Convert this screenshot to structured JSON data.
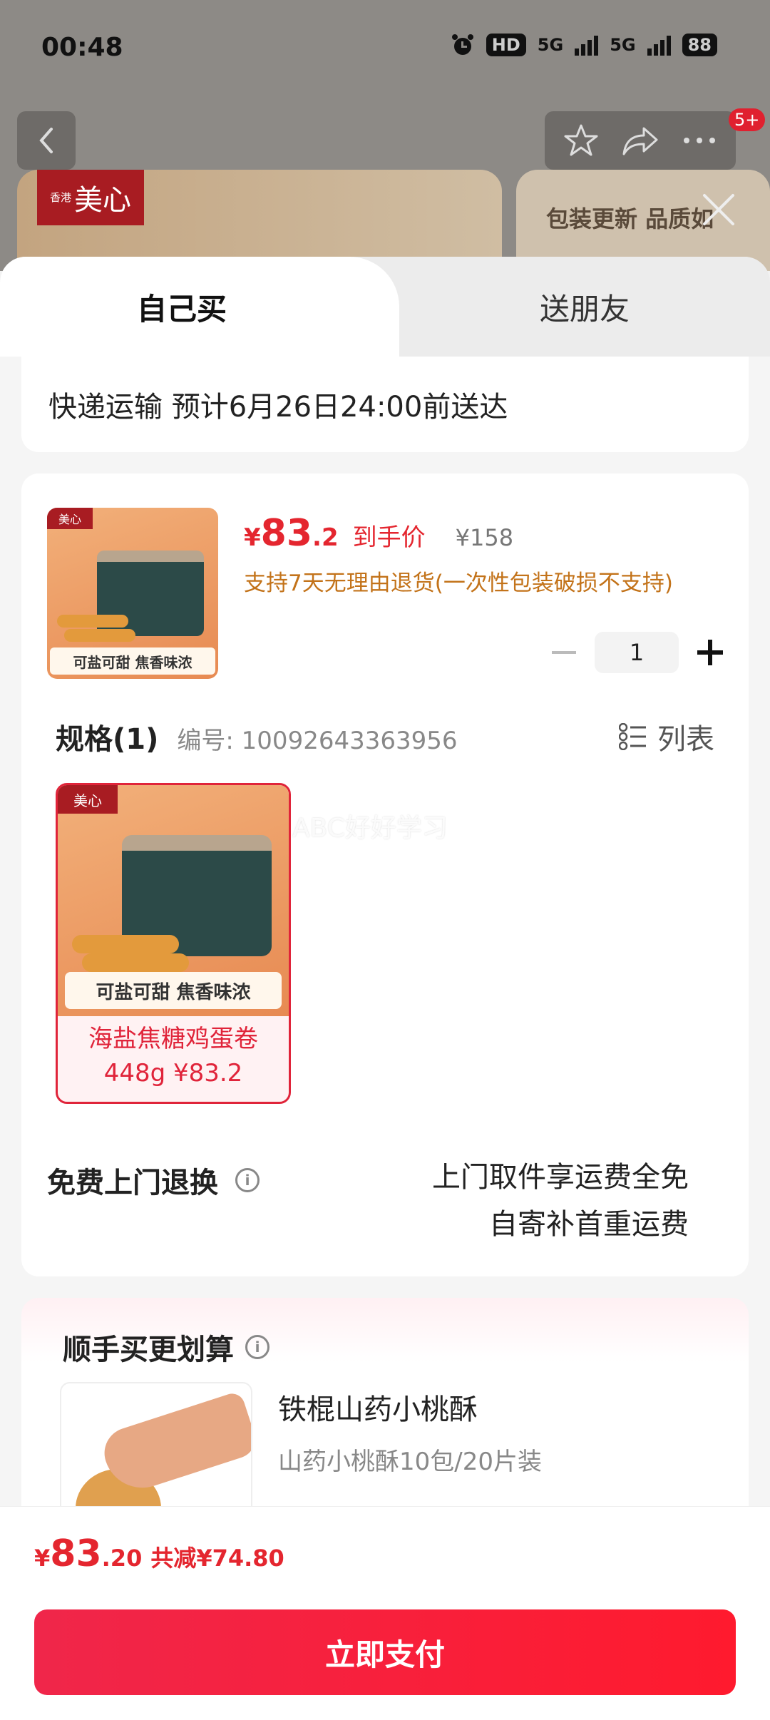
{
  "status_bar": {
    "time": "00:48",
    "hd": "HD",
    "net1": "5G",
    "net2": "5G",
    "battery": "88"
  },
  "nav": {
    "badge": "5+"
  },
  "background": {
    "brand_small": "香港",
    "brand_main": "美心",
    "banner_text": "包装更新 品质如"
  },
  "tabs": {
    "self_buy": "自己买",
    "gift": "送朋友"
  },
  "delivery": {
    "text": "快递运输 预计6月26日24:00前送达"
  },
  "product": {
    "thumb_logo": "美心",
    "thumb_label": "可盐可甜 焦香味浓",
    "price_currency": "¥",
    "price_int": "83",
    "price_dec": ".2",
    "price_tag": "到手价",
    "original_price": "¥158",
    "return_note": "支持7天无理由退货(一次性包装破损不支持)",
    "quantity": "1"
  },
  "spec": {
    "title": "规格(1)",
    "code": "编号: 10092643363956",
    "list_label": "列表",
    "item_logo": "美心",
    "item_label": "可盐可甜 焦香味浓",
    "item_name_line1": "海盐焦糖鸡蛋卷",
    "item_name_line2": "448g ¥83.2",
    "watermark": "ABC好好学习"
  },
  "free_return": {
    "title": "免费上门退换",
    "line1": "上门取件享运费全免",
    "line2": "自寄补首重运费"
  },
  "upsell": {
    "title": "顺手买更划算",
    "item_name": "铁棍山药小桃酥",
    "item_desc": "山药小桃酥10包/20片装"
  },
  "bottom": {
    "currency": "¥",
    "total_int": "83",
    "total_dec": ".20",
    "reduce": "共减¥74.80",
    "pay_button": "立即支付"
  },
  "colors": {
    "accent_red": "#e4262f",
    "return_note_orange": "#c3731a",
    "pay_gradient_start": "#f0264a",
    "pay_gradient_end": "#ff1a2e"
  }
}
